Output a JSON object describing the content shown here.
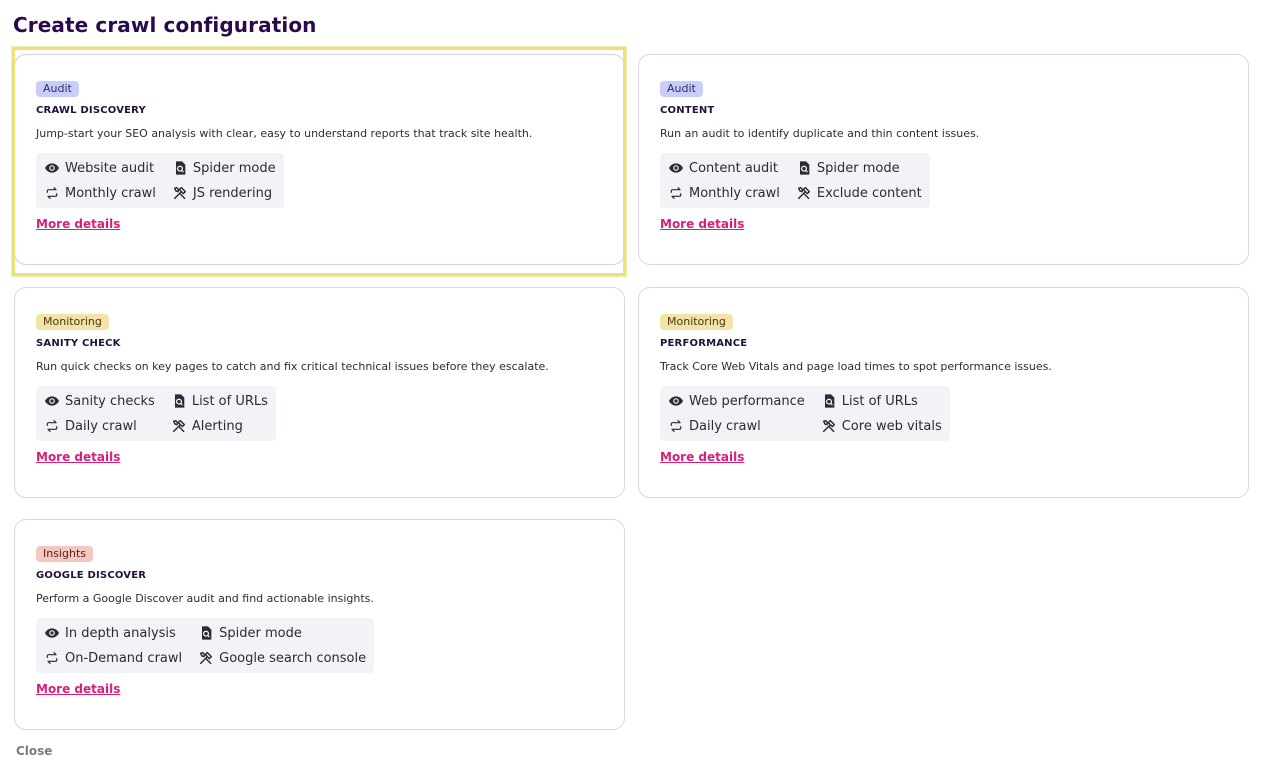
{
  "page_title": "Create crawl configuration",
  "cards": [
    {
      "badge": "Audit",
      "title": "CRAWL DISCOVERY",
      "description": "Jump-start your SEO analysis with clear, easy to understand reports that track site health.",
      "features": {
        "audit": "Website audit",
        "mode": "Spider mode",
        "frequency": "Monthly crawl",
        "tool": "JS rendering"
      },
      "more": "More details"
    },
    {
      "badge": "Audit",
      "title": "CONTENT",
      "description": "Run an audit to identify duplicate and thin content issues.",
      "features": {
        "audit": "Content audit",
        "mode": "Spider mode",
        "frequency": "Monthly crawl",
        "tool": "Exclude content"
      },
      "more": "More details"
    },
    {
      "badge": "Monitoring",
      "title": "SANITY CHECK",
      "description": "Run quick checks on key pages to catch and fix critical technical issues before they escalate.",
      "features": {
        "audit": "Sanity checks",
        "mode": "List of URLs",
        "frequency": "Daily crawl",
        "tool": "Alerting"
      },
      "more": "More details"
    },
    {
      "badge": "Monitoring",
      "title": "PERFORMANCE",
      "description": "Track Core Web Vitals and page load times to spot performance issues.",
      "features": {
        "audit": "Web performance",
        "mode": "List of URLs",
        "frequency": "Daily crawl",
        "tool": "Core web vitals"
      },
      "more": "More details"
    },
    {
      "badge": "Insights",
      "title": "GOOGLE DISCOVER",
      "description": "Perform a Google Discover audit and find actionable insights.",
      "features": {
        "audit": "In depth analysis",
        "mode": "Spider mode",
        "frequency": "On-Demand crawl",
        "tool": "Google search console"
      },
      "more": "More details"
    }
  ],
  "close_label": "Close",
  "colors": {
    "title": "#2a0a4a",
    "link": "#d6207a",
    "badge_audit": "#c9cef9",
    "badge_monitoring": "#f3e3a8",
    "badge_insights": "#f6c7c1",
    "selection": "#ece07f"
  },
  "icons": {
    "audit": "eye-icon",
    "mode": "search-document-icon",
    "frequency": "repeat-icon",
    "tool": "tools-icon"
  }
}
